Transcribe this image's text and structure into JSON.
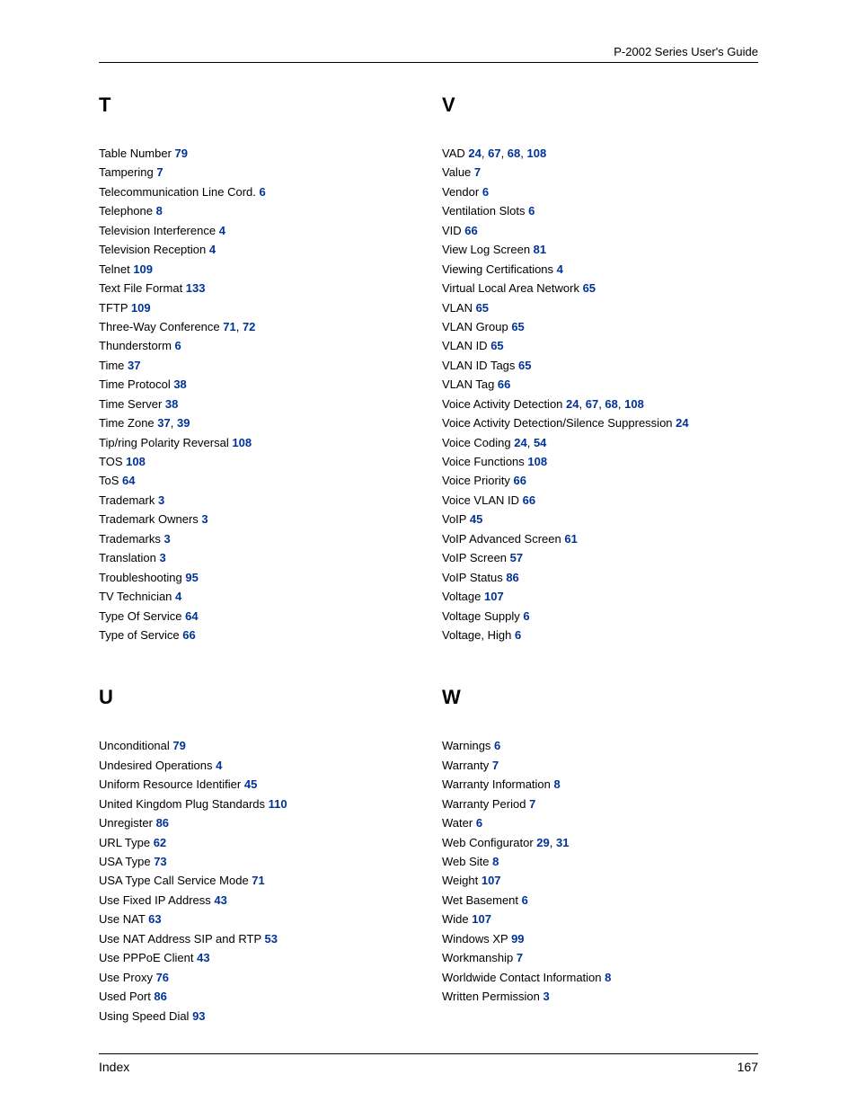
{
  "header": {
    "title": "P-2002 Series User's Guide"
  },
  "footer": {
    "left": "Index",
    "right": "167"
  },
  "sections": [
    {
      "heading": "T",
      "column": "left",
      "entries": [
        {
          "term": "Table Number",
          "pages": [
            "79"
          ]
        },
        {
          "term": "Tampering",
          "pages": [
            "7"
          ]
        },
        {
          "term": "Telecommunication Line Cord.",
          "pages": [
            "6"
          ]
        },
        {
          "term": "Telephone",
          "pages": [
            "8"
          ]
        },
        {
          "term": "Television Interference",
          "pages": [
            "4"
          ]
        },
        {
          "term": "Television Reception",
          "pages": [
            "4"
          ]
        },
        {
          "term": "Telnet",
          "pages": [
            "109"
          ]
        },
        {
          "term": "Text File Format",
          "pages": [
            "133"
          ]
        },
        {
          "term": "TFTP",
          "pages": [
            "109"
          ]
        },
        {
          "term": "Three-Way Conference",
          "pages": [
            "71",
            "72"
          ]
        },
        {
          "term": "Thunderstorm",
          "pages": [
            "6"
          ]
        },
        {
          "term": "Time",
          "pages": [
            "37"
          ]
        },
        {
          "term": "Time Protocol",
          "pages": [
            "38"
          ]
        },
        {
          "term": "Time Server",
          "pages": [
            "38"
          ]
        },
        {
          "term": "Time Zone",
          "pages": [
            "37",
            "39"
          ]
        },
        {
          "term": "Tip/ring Polarity Reversal",
          "pages": [
            "108"
          ]
        },
        {
          "term": "TOS",
          "pages": [
            "108"
          ]
        },
        {
          "term": "ToS",
          "pages": [
            "64"
          ]
        },
        {
          "term": "Trademark",
          "pages": [
            "3"
          ]
        },
        {
          "term": "Trademark Owners",
          "pages": [
            "3"
          ]
        },
        {
          "term": "Trademarks",
          "pages": [
            "3"
          ]
        },
        {
          "term": "Translation",
          "pages": [
            "3"
          ]
        },
        {
          "term": "Troubleshooting",
          "pages": [
            "95"
          ]
        },
        {
          "term": "TV Technician",
          "pages": [
            "4"
          ]
        },
        {
          "term": "Type Of Service",
          "pages": [
            "64"
          ]
        },
        {
          "term": "Type of Service",
          "pages": [
            "66"
          ]
        }
      ]
    },
    {
      "heading": "U",
      "column": "left",
      "entries": [
        {
          "term": "Unconditional",
          "pages": [
            "79"
          ]
        },
        {
          "term": "Undesired Operations",
          "pages": [
            "4"
          ]
        },
        {
          "term": "Uniform Resource Identifier",
          "pages": [
            "45"
          ]
        },
        {
          "term": "United Kingdom Plug Standards",
          "pages": [
            "110"
          ]
        },
        {
          "term": "Unregister",
          "pages": [
            "86"
          ]
        },
        {
          "term": "URL Type",
          "pages": [
            "62"
          ]
        },
        {
          "term": "USA Type",
          "pages": [
            "73"
          ]
        },
        {
          "term": "USA Type Call Service Mode",
          "pages": [
            "71"
          ]
        },
        {
          "term": "Use Fixed IP Address",
          "pages": [
            "43"
          ]
        },
        {
          "term": "Use NAT",
          "pages": [
            "63"
          ]
        },
        {
          "term": "Use NAT Address SIP and RTP",
          "pages": [
            "53"
          ]
        },
        {
          "term": "Use PPPoE Client",
          "pages": [
            "43"
          ]
        },
        {
          "term": "Use Proxy",
          "pages": [
            "76"
          ]
        },
        {
          "term": "Used Port",
          "pages": [
            "86"
          ]
        },
        {
          "term": "Using Speed Dial",
          "pages": [
            "93"
          ]
        }
      ]
    },
    {
      "heading": "V",
      "column": "right",
      "entries": [
        {
          "term": "VAD",
          "pages": [
            "24",
            "67",
            "68",
            "108"
          ]
        },
        {
          "term": "Value",
          "pages": [
            "7"
          ]
        },
        {
          "term": "Vendor",
          "pages": [
            "6"
          ]
        },
        {
          "term": "Ventilation Slots",
          "pages": [
            "6"
          ]
        },
        {
          "term": "VID",
          "pages": [
            "66"
          ]
        },
        {
          "term": "View Log Screen",
          "pages": [
            "81"
          ]
        },
        {
          "term": "Viewing Certifications",
          "pages": [
            "4"
          ]
        },
        {
          "term": "Virtual Local Area Network",
          "pages": [
            "65"
          ]
        },
        {
          "term": "VLAN",
          "pages": [
            "65"
          ]
        },
        {
          "term": "VLAN Group",
          "pages": [
            "65"
          ]
        },
        {
          "term": "VLAN ID",
          "pages": [
            "65"
          ]
        },
        {
          "term": "VLAN ID Tags",
          "pages": [
            "65"
          ]
        },
        {
          "term": "VLAN Tag",
          "pages": [
            "66"
          ]
        },
        {
          "term": "Voice Activity Detection",
          "pages": [
            "24",
            "67",
            "68",
            "108"
          ]
        },
        {
          "term": "Voice Activity Detection/Silence Suppression",
          "pages": [
            "24"
          ]
        },
        {
          "term": "Voice Coding",
          "pages": [
            "24",
            "54"
          ]
        },
        {
          "term": "Voice Functions",
          "pages": [
            "108"
          ]
        },
        {
          "term": "Voice Priority",
          "pages": [
            "66"
          ]
        },
        {
          "term": "Voice VLAN ID",
          "pages": [
            "66"
          ]
        },
        {
          "term": "VoIP",
          "pages": [
            "45"
          ]
        },
        {
          "term": "VoIP Advanced Screen",
          "pages": [
            "61"
          ]
        },
        {
          "term": "VoIP Screen",
          "pages": [
            "57"
          ]
        },
        {
          "term": "VoIP Status",
          "pages": [
            "86"
          ]
        },
        {
          "term": "Voltage",
          "pages": [
            "107"
          ]
        },
        {
          "term": "Voltage Supply",
          "pages": [
            "6"
          ]
        },
        {
          "term": "Voltage, High",
          "pages": [
            "6"
          ]
        }
      ]
    },
    {
      "heading": "W",
      "column": "right",
      "entries": [
        {
          "term": "Warnings",
          "pages": [
            "6"
          ]
        },
        {
          "term": "Warranty",
          "pages": [
            "7"
          ]
        },
        {
          "term": "Warranty Information",
          "pages": [
            "8"
          ]
        },
        {
          "term": "Warranty Period",
          "pages": [
            "7"
          ]
        },
        {
          "term": "Water",
          "pages": [
            "6"
          ]
        },
        {
          "term": "Web Configurator",
          "pages": [
            "29",
            "31"
          ]
        },
        {
          "term": "Web Site",
          "pages": [
            "8"
          ]
        },
        {
          "term": "Weight",
          "pages": [
            "107"
          ]
        },
        {
          "term": "Wet Basement",
          "pages": [
            "6"
          ]
        },
        {
          "term": "Wide",
          "pages": [
            "107"
          ]
        },
        {
          "term": "Windows XP",
          "pages": [
            "99"
          ]
        },
        {
          "term": "Workmanship",
          "pages": [
            "7"
          ]
        },
        {
          "term": "Worldwide Contact Information",
          "pages": [
            "8"
          ]
        },
        {
          "term": "Written Permission",
          "pages": [
            "3"
          ]
        }
      ]
    }
  ]
}
